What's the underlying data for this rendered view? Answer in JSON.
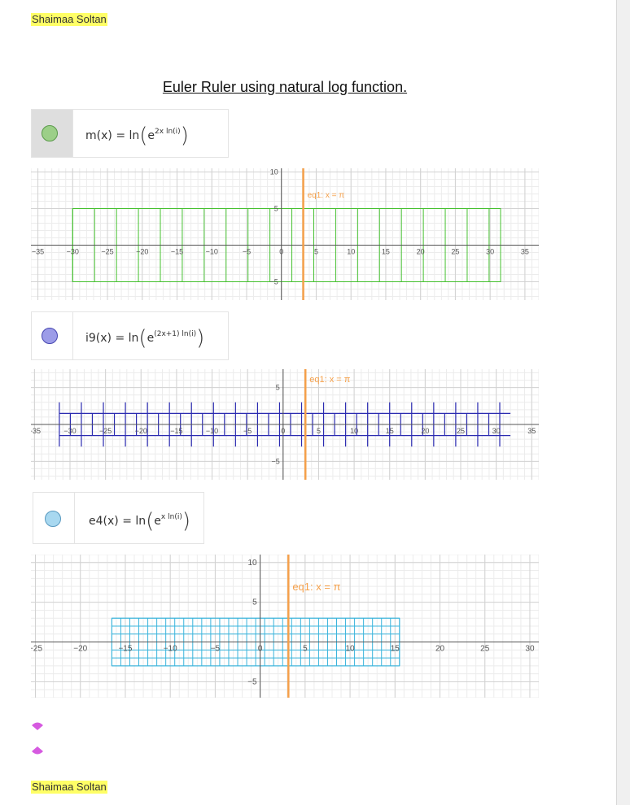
{
  "author": "Shaimaa Soltan",
  "title": "Euler Ruler using natural log function.",
  "expressions": [
    {
      "name": "m(x)",
      "eq": "=",
      "ln": "ln",
      "base": "e",
      "exponent": "2x ln(i)",
      "color": "#9ccf88",
      "selected": true
    },
    {
      "name": "i9(x)",
      "eq": "=",
      "ln": "ln",
      "base": "e",
      "exponent": "(2x+1) ln(i)",
      "color": "#8c8ce6",
      "selected": false
    },
    {
      "name": "e4(x)",
      "eq": "=",
      "ln": "ln",
      "base": "e",
      "exponent": "x ln(i)",
      "color": "#a8d8f0",
      "selected": false
    }
  ],
  "plots": [
    {
      "xticks": [
        "−35",
        "−30",
        "−25",
        "−20",
        "−15",
        "−10",
        "−5",
        "0",
        "5",
        "10",
        "15",
        "20",
        "25",
        "30",
        "35"
      ],
      "yticks": [
        "10",
        "5",
        "−5"
      ],
      "curve_label": "eq1: x = π",
      "curve_color": "#f5a04a",
      "box_color": "#44c02e",
      "xrange": [
        -36,
        37
      ],
      "yrange": [
        -7.5,
        10.5
      ]
    },
    {
      "xticks": [
        "−35",
        "−30",
        "−25",
        "−20",
        "−15",
        "−10",
        "−5",
        "0",
        "5",
        "10",
        "15",
        "20",
        "25",
        "30",
        "35"
      ],
      "yticks": [
        "5",
        "−5"
      ],
      "curve_label": "eq1: x = π",
      "curve_color": "#f5a04a",
      "box_color": "#2a2ab0",
      "xrange": [
        -35.5,
        36
      ],
      "yrange": [
        -7.5,
        7.5
      ]
    },
    {
      "xticks": [
        "−25",
        "−20",
        "−15",
        "−10",
        "−5",
        "0",
        "5",
        "10",
        "15",
        "20",
        "25",
        "30"
      ],
      "yticks": [
        "10",
        "5",
        "−5"
      ],
      "curve_label": "eq1: x = π",
      "curve_color": "#f5a04a",
      "box_color": "#3ab4dc",
      "xrange": [
        -25.5,
        31
      ],
      "yrange": [
        -7,
        11
      ]
    }
  ],
  "bullet_color": "#d65ae0"
}
